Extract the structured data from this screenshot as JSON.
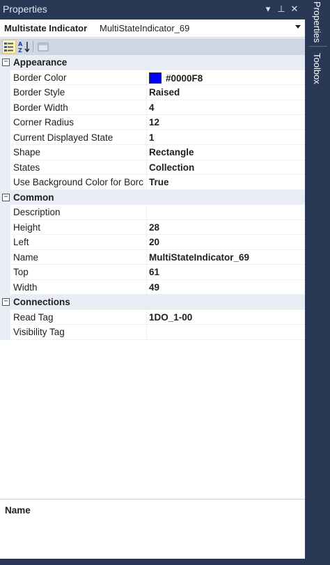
{
  "window": {
    "title": "Properties",
    "pin_glyph": "▾",
    "autohide_glyph": "⊥",
    "close_glyph": "✕"
  },
  "side_tabs": [
    "Properties",
    "Toolbox"
  ],
  "selector": {
    "object_type": "Multistate Indicator",
    "object_name": "MultiStateIndicator_69",
    "dropdown_icon": "chevron-down-icon"
  },
  "toolbar": {
    "icons": [
      "categorized-icon",
      "alphabetical-sort-icon",
      "property-pages-icon"
    ]
  },
  "categories": [
    {
      "name": "Appearance",
      "toggle": "−",
      "properties": [
        {
          "name": "Border Color",
          "value": "#0000F8",
          "swatch": "#0000F8"
        },
        {
          "name": "Border Style",
          "value": "Raised"
        },
        {
          "name": "Border Width",
          "value": "4"
        },
        {
          "name": "Corner Radius",
          "value": "12"
        },
        {
          "name": "Current Displayed State",
          "value": "1"
        },
        {
          "name": "Shape",
          "value": "Rectangle"
        },
        {
          "name": "States",
          "value": "Collection"
        },
        {
          "name": "Use Background Color for Borc",
          "value": "True"
        }
      ]
    },
    {
      "name": "Common",
      "toggle": "−",
      "properties": [
        {
          "name": "Description",
          "value": ""
        },
        {
          "name": "Height",
          "value": "28"
        },
        {
          "name": "Left",
          "value": "20"
        },
        {
          "name": "Name",
          "value": "MultiStateIndicator_69"
        },
        {
          "name": "Top",
          "value": "61"
        },
        {
          "name": "Width",
          "value": "49"
        }
      ]
    },
    {
      "name": "Connections",
      "toggle": "−",
      "properties": [
        {
          "name": "Read Tag",
          "value": "1DO_1-00"
        },
        {
          "name": "Visibility Tag",
          "value": ""
        }
      ]
    }
  ],
  "description": {
    "title": "Name"
  },
  "colors": {
    "chrome": "#293955",
    "category_bg": "#e8ecf4",
    "toolbar_bg": "#cfd6e5"
  }
}
